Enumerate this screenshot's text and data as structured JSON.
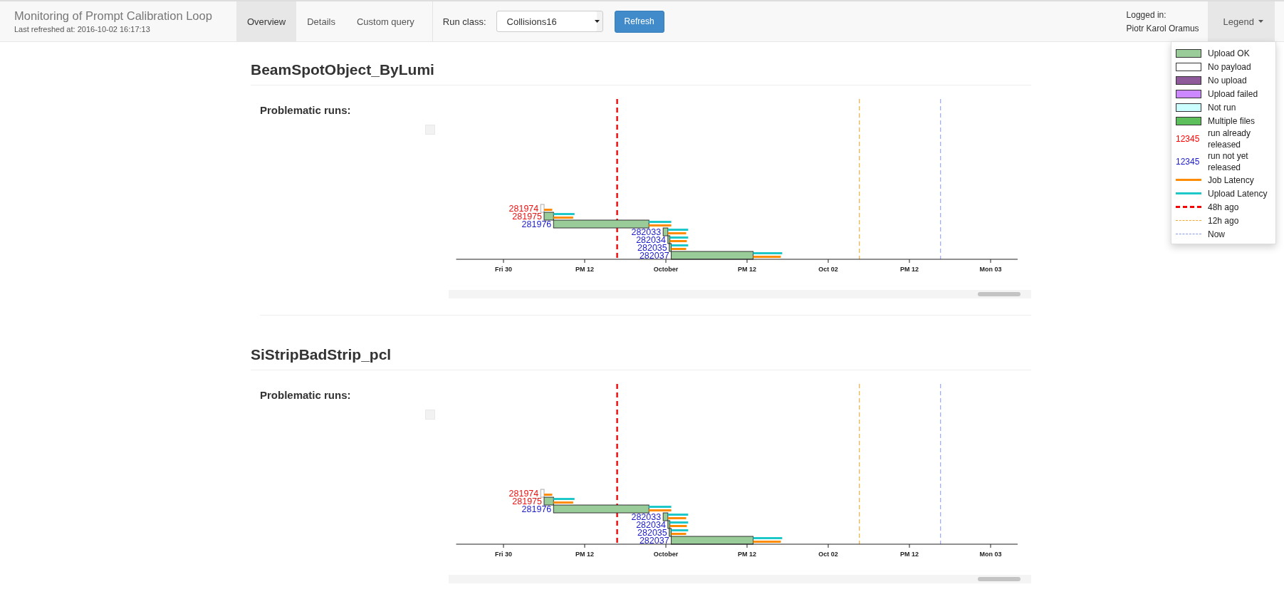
{
  "navbar": {
    "title": "Monitoring of Prompt Calibration Loop",
    "subtitle": "Last refreshed at: 2016-10-02 16:17:13",
    "tabs": [
      {
        "label": "Overview",
        "selected": true
      },
      {
        "label": "Details",
        "selected": false
      },
      {
        "label": "Custom query",
        "selected": false
      }
    ],
    "run_class": {
      "label": "Run class:",
      "value": "Collisions16"
    },
    "refresh_button": "Refresh",
    "user": {
      "label": "Logged in:",
      "name": "Piotr Karol Oramus"
    },
    "legend_button": {
      "label": "Legend",
      "expanded": true
    }
  },
  "legend": [
    {
      "kind": "box",
      "label": "Upload OK",
      "color": "#99cc99"
    },
    {
      "kind": "box",
      "label": "No payload",
      "color": "#ffffff"
    },
    {
      "kind": "box",
      "label": "No upload",
      "color": "#8e5a9a"
    },
    {
      "kind": "box",
      "label": "Upload failed",
      "color": "#cc88ff"
    },
    {
      "kind": "box",
      "label": "Not run",
      "color": "#ccffff"
    },
    {
      "kind": "box",
      "label": "Multiple files",
      "color": "#5cbf5c"
    },
    {
      "kind": "run",
      "sample": "12345",
      "label": "run already released",
      "color": "#ff0000"
    },
    {
      "kind": "run",
      "sample": "12345",
      "label": "run not yet released",
      "color": "#1a1acc"
    },
    {
      "kind": "line",
      "label": "Job Latency",
      "color": "#ff8c00"
    },
    {
      "kind": "line",
      "label": "Upload Latency",
      "color": "#1fc8c8"
    },
    {
      "kind": "dashed",
      "label": "48h ago",
      "color": "#ff0000"
    },
    {
      "kind": "thin-dashed",
      "label": "12h ago",
      "color": "#f0a830"
    },
    {
      "kind": "thin-dashed",
      "label": "Now",
      "color": "#8899dd"
    }
  ],
  "sections": [
    {
      "title": "BeamSpotObject_ByLumi",
      "problematic_label": "Problematic runs:",
      "runs": [
        {
          "label": "281974",
          "released": true,
          "kind": "no_payload"
        },
        {
          "label": "281975",
          "released": true,
          "kind": "upload_ok"
        },
        {
          "label": "281976",
          "released": false,
          "kind": "upload_ok"
        },
        {
          "label": "282033",
          "released": false,
          "kind": "upload_ok"
        },
        {
          "label": "282034",
          "released": false,
          "kind": "upload_ok"
        },
        {
          "label": "282035",
          "released": false,
          "kind": "upload_ok"
        },
        {
          "label": "282037",
          "released": false,
          "kind": "upload_ok"
        }
      ],
      "axis_labels": [
        "Fri 30",
        "PM 12",
        "October",
        "PM 12",
        "Oct 02",
        "PM 12",
        "Mon 03"
      ]
    },
    {
      "title": "SiStripBadStrip_pcl",
      "problematic_label": "Problematic runs:",
      "runs": [
        {
          "label": "281974",
          "released": true,
          "kind": "no_payload"
        },
        {
          "label": "281975",
          "released": true,
          "kind": "upload_ok"
        },
        {
          "label": "281976",
          "released": false,
          "kind": "upload_ok"
        },
        {
          "label": "282033",
          "released": false,
          "kind": "upload_ok"
        },
        {
          "label": "282034",
          "released": false,
          "kind": "upload_ok"
        },
        {
          "label": "282035",
          "released": false,
          "kind": "upload_ok"
        },
        {
          "label": "282037",
          "released": false,
          "kind": "upload_ok"
        }
      ],
      "axis_labels": [
        "Fri 30",
        "PM 12",
        "October",
        "PM 12",
        "Oct 02",
        "PM 12",
        "Mon 03"
      ]
    }
  ]
}
